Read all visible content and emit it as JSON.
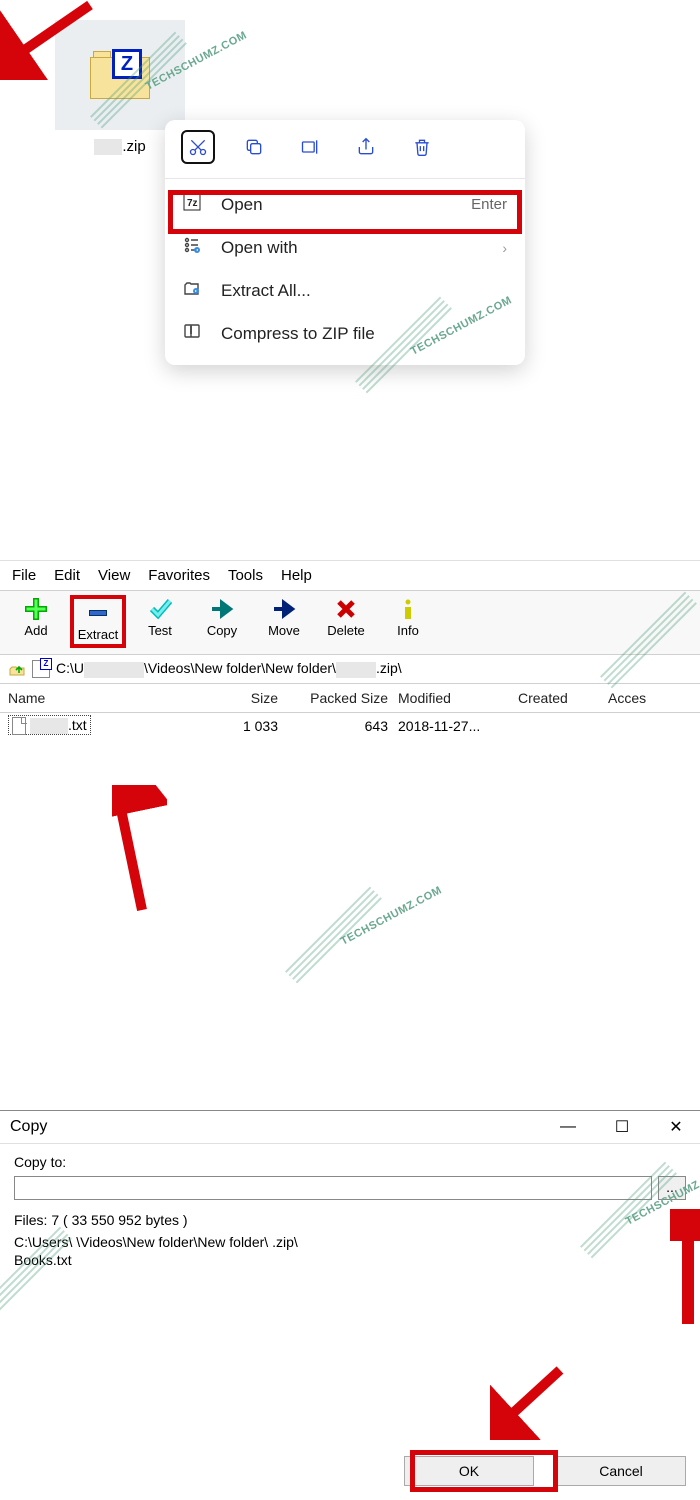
{
  "watermark": "TECHSCHUMZ.COM",
  "section1": {
    "file_label": ".zip",
    "toolbar_icons": [
      "cut",
      "copy",
      "rename",
      "share",
      "delete"
    ],
    "menu": {
      "open": {
        "label": "Open",
        "shortcut": "Enter"
      },
      "open_with": {
        "label": "Open with"
      },
      "extract_all": {
        "label": "Extract All..."
      },
      "compress": {
        "label": "Compress to ZIP file"
      }
    }
  },
  "section2": {
    "menubar": [
      "File",
      "Edit",
      "View",
      "Favorites",
      "Tools",
      "Help"
    ],
    "toolbar": {
      "add": "Add",
      "extract": "Extract",
      "test": "Test",
      "copy": "Copy",
      "move": "Move",
      "delete": "Delete",
      "info": "Info"
    },
    "path_prefix": "C:\\U",
    "path_middle": "\\Videos\\New folder\\New folder\\",
    "path_suffix": ".zip\\",
    "columns": {
      "name": "Name",
      "size": "Size",
      "packed": "Packed Size",
      "modified": "Modified",
      "created": "Created",
      "acces": "Acces"
    },
    "row": {
      "name": ".txt",
      "size": "1 033",
      "packed": "643",
      "modified": "2018-11-27..."
    }
  },
  "section3": {
    "title": "Copy",
    "copy_to_label": "Copy to:",
    "input_value": "",
    "browse": "...",
    "files_info": "Files: 7 ( 33 550 952 bytes )",
    "path_line": "C:\\Users\\      \\Videos\\New folder\\New folder\\        .zip\\",
    "file_line": "Books.txt",
    "ok": "OK",
    "cancel": "Cancel",
    "min": "—",
    "max": "☐",
    "close": "✕"
  }
}
